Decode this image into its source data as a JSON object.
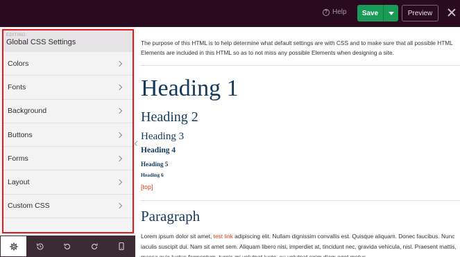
{
  "topbar": {
    "help_label": "Help",
    "save_label": "Save",
    "preview_label": "Preview"
  },
  "sidebar": {
    "editing_label": "EDITING:",
    "title": "Global CSS Settings",
    "items": [
      {
        "label": "Colors"
      },
      {
        "label": "Fonts"
      },
      {
        "label": "Background"
      },
      {
        "label": "Buttons"
      },
      {
        "label": "Forms"
      },
      {
        "label": "Layout"
      },
      {
        "label": "Custom CSS"
      }
    ]
  },
  "bottom_toolbar": {
    "icons": [
      "gear-icon",
      "history-icon",
      "undo-icon",
      "redo-icon",
      "mobile-preview-icon"
    ]
  },
  "content": {
    "intro": "The purpose of this HTML is to help determine what default settings are with CSS and to make sure that all possible HTML Elements are included in this HTML so as to not miss any possible Elements when designing a site.",
    "h1": "Heading 1",
    "h2": "Heading 2",
    "h3": "Heading 3",
    "h4": "Heading 4",
    "h5": "Heading 5",
    "h6": "Heading 6",
    "top_link": "[top]",
    "paragraph_heading": "Paragraph",
    "paragraph_before_link": "Lorem ipsum dolor sit amet, ",
    "paragraph_link": "test link",
    "paragraph_after_link": " adipiscing elit. Nullam dignissim convallis est. Quisque aliquam. Donec faucibus. Nunc iaculis suscipit dui. Nam sit amet sem. Aliquam libero nisi, imperdiet at, tincidunt nec, gravida vehicula, nisl. Praesent mattis, massa quis luctus fermentum, turpis mi volutpat justo, eu volutpat enim diam eget metus."
  },
  "colors": {
    "topbar_bg": "#2a0a1e",
    "save_green": "#1a9a57",
    "heading_navy": "#15395a",
    "link_red": "#d8401c",
    "highlight_red": "#e01b1b",
    "bottombar_bg": "#3a2b35"
  }
}
